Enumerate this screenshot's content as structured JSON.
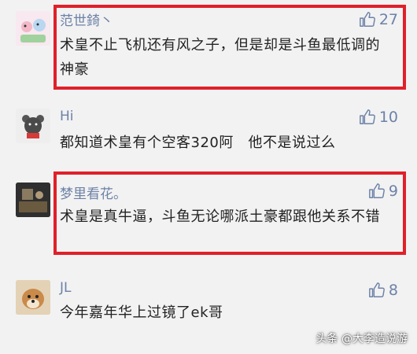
{
  "comments": [
    {
      "username": "范世錡丶",
      "likes": "27",
      "text": "术皇不止飞机还有风之子，但是却是斗鱼最低调的神豪"
    },
    {
      "username": "Hi",
      "likes": "10",
      "text": "都知道术皇有个空客320阿   他不是说过么"
    },
    {
      "username": "梦里看花。",
      "likes": "9",
      "text": "术皇是真牛逼，斗鱼无论哪派土豪都跟他关系不错"
    },
    {
      "username": "JL",
      "likes": "8",
      "text": "今年嘉年华上过镜了ek哥"
    }
  ],
  "watermark": "头条 @大李造说游",
  "colors": {
    "highlight": "#e0202a",
    "username": "#6d82a8",
    "text": "#222222"
  }
}
